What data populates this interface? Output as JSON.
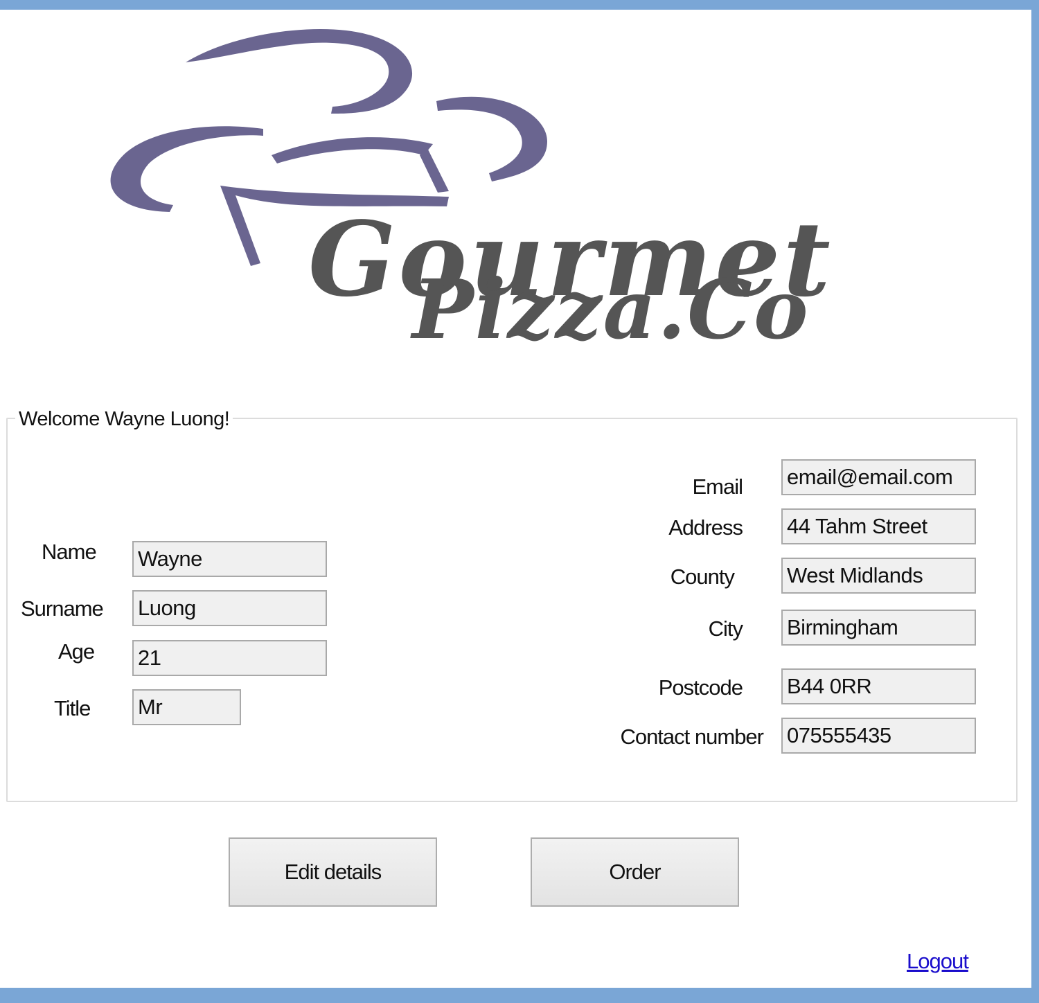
{
  "logo": {
    "line1": "Gourmet",
    "line2": "Pizza.Co",
    "hat_color": "#6a6590",
    "text_color": "#555555"
  },
  "welcome": "Welcome Wayne Luong!",
  "personal": {
    "name_label": "Name",
    "name_value": "Wayne",
    "surname_label": "Surname",
    "surname_value": "Luong",
    "age_label": "Age",
    "age_value": "21",
    "title_label": "Title",
    "title_value": "Mr"
  },
  "contact": {
    "email_label": "Email",
    "email_value": "email@email.com",
    "address_label": "Address",
    "address_value": "44 Tahm Street",
    "county_label": "County",
    "county_value": "West Midlands",
    "city_label": "City",
    "city_value": "Birmingham",
    "postcode_label": "Postcode",
    "postcode_value": "B44 0RR",
    "contact_number_label": "Contact number",
    "contact_number_value": "075555435"
  },
  "buttons": {
    "edit_details": "Edit details",
    "order": "Order"
  },
  "logout": "Logout"
}
